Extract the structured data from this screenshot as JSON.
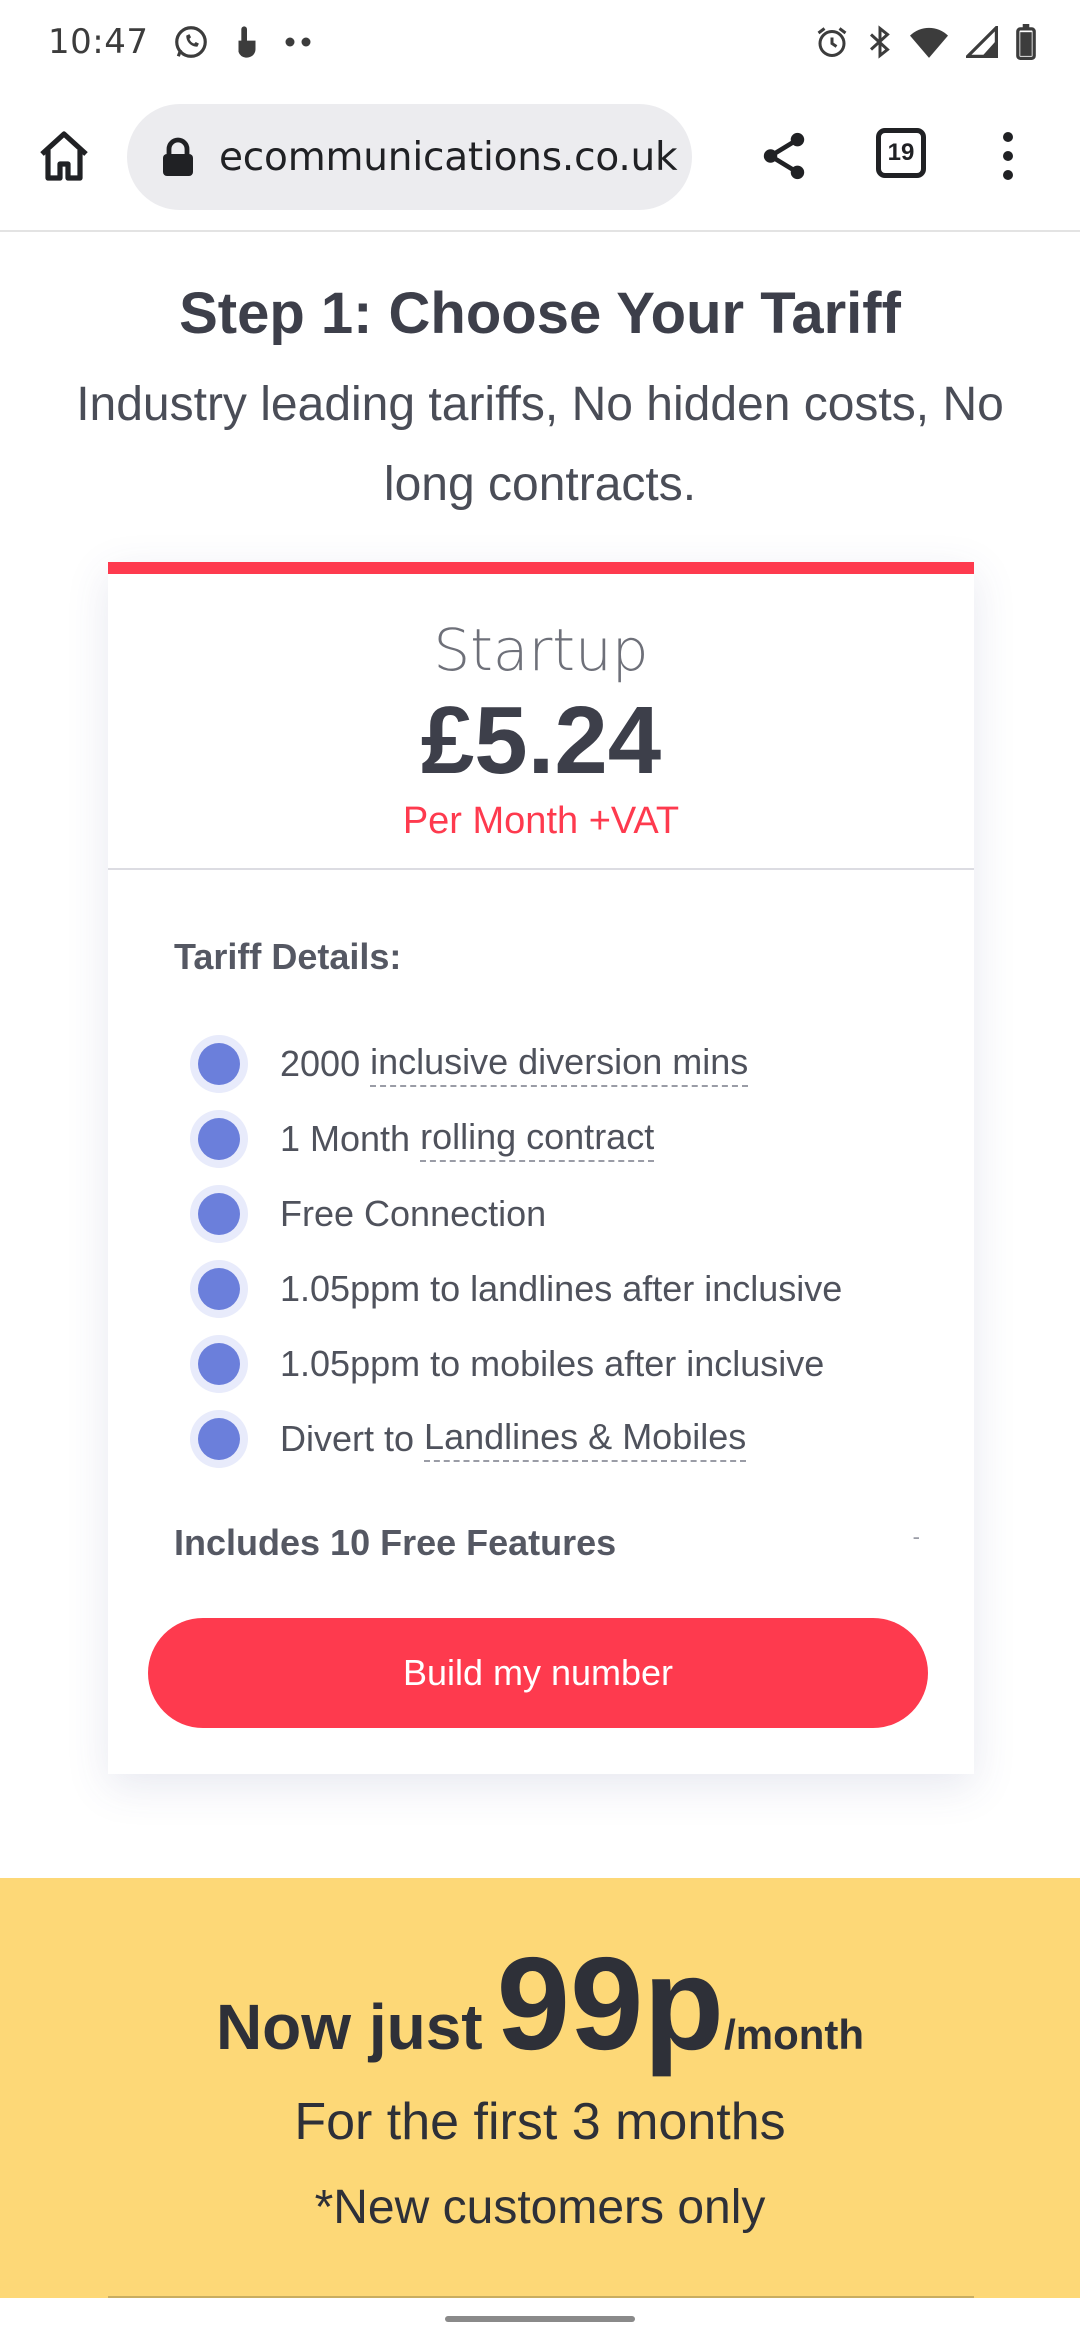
{
  "status_bar": {
    "time": "10:47",
    "left_icons": [
      "whatsapp-icon",
      "touch-icon",
      "more-dots-icon"
    ],
    "right_icons": [
      "alarm-icon",
      "bluetooth-icon",
      "wifi-icon",
      "signal-icon",
      "battery-icon"
    ]
  },
  "browser": {
    "url": "ecommunications.co.uk",
    "tab_count": "19"
  },
  "heading": {
    "title": "Step 1: Choose Your Tariff",
    "subtitle": "Industry leading tariffs, No hidden costs, No long contracts."
  },
  "tariff": {
    "name": "Startup",
    "price": "£5.24",
    "period": "Per Month +VAT",
    "details_label": "Tariff Details:",
    "features": [
      {
        "prefix": "2000 ",
        "link": "inclusive diversion mins"
      },
      {
        "prefix": "1 Month ",
        "link": "rolling contract"
      },
      {
        "prefix": "Free Connection",
        "link": ""
      },
      {
        "prefix": "1.05ppm to landlines after inclusive",
        "link": ""
      },
      {
        "prefix": "1.05ppm to mobiles after inclusive",
        "link": ""
      },
      {
        "prefix": "Divert to ",
        "link": "Landlines & Mobiles"
      }
    ],
    "features_label": "Includes 10 Free Features",
    "features_toggle": "-",
    "cta": "Build my number"
  },
  "promo": {
    "prefix": "Now just",
    "price": "99p",
    "unit": "/month",
    "line2": "For the first 3 months",
    "line3": "*New customers only"
  },
  "colors": {
    "accent": "#fe3a4e",
    "bullet": "#6b7fdb",
    "promo_bg": "#fdd877"
  }
}
